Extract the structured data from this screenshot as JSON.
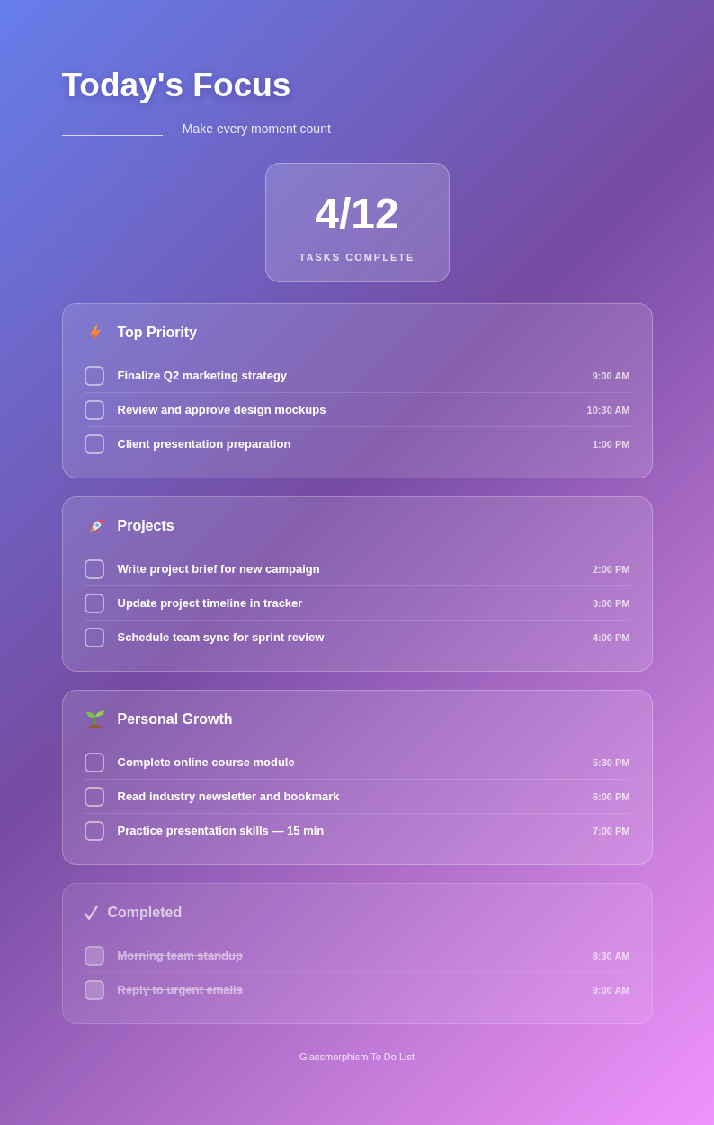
{
  "header": {
    "title": "Today's Focus",
    "separator": "·",
    "subtitle": "Make every moment count"
  },
  "stats": {
    "count": "4/12",
    "label": "TASKS COMPLETE"
  },
  "sections": [
    {
      "kind": "priority",
      "title": "Top Priority",
      "muted": false,
      "tasks": [
        {
          "text": "Finalize Q2 marketing strategy",
          "time": "9:00 AM",
          "checked": false
        },
        {
          "text": "Review and approve design mockups",
          "time": "10:30 AM",
          "checked": false
        },
        {
          "text": "Client presentation preparation",
          "time": "1:00 PM",
          "checked": false
        }
      ]
    },
    {
      "kind": "projects",
      "title": "Projects",
      "muted": false,
      "tasks": [
        {
          "text": "Write project brief for new campaign",
          "time": "2:00 PM",
          "checked": false
        },
        {
          "text": "Update project timeline in tracker",
          "time": "3:00 PM",
          "checked": false
        },
        {
          "text": "Schedule team sync for sprint review",
          "time": "4:00 PM",
          "checked": false
        }
      ]
    },
    {
      "kind": "growth",
      "title": "Personal Growth",
      "muted": false,
      "tasks": [
        {
          "text": "Complete online course module",
          "time": "5:30 PM",
          "checked": false
        },
        {
          "text": "Read industry newsletter and bookmark",
          "time": "6:00 PM",
          "checked": false
        },
        {
          "text": "Practice presentation skills — 15 min",
          "time": "7:00 PM",
          "checked": false
        }
      ]
    },
    {
      "kind": "done",
      "title": "Completed",
      "muted": true,
      "tasks": [
        {
          "text": "Morning team standup",
          "time": "8:30 AM",
          "checked": true
        },
        {
          "text": "Reply to urgent emails",
          "time": "9:00 AM",
          "checked": true
        }
      ]
    }
  ],
  "footer": "Glassmorphism To Do List"
}
